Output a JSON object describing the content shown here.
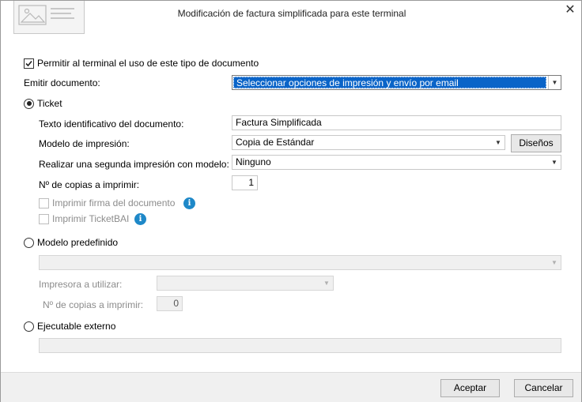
{
  "window": {
    "title": "Modificación de factura simplificada para este terminal"
  },
  "permit": {
    "label": "Permitir al terminal el uso de este tipo de documento",
    "checked": true
  },
  "emit": {
    "label": "Emitir documento:",
    "value": "Seleccionar opciones de impresión y envío por email"
  },
  "ticket": {
    "radio_label": "Ticket",
    "selected": true,
    "text_id_label": "Texto identificativo del documento:",
    "text_id_value": "Factura Simplificada",
    "model_label": "Modelo de impresión:",
    "model_value": "Copia de Estándar",
    "designs_button": "Diseños",
    "second_print_label": "Realizar una segunda impresión con modelo:",
    "second_print_value": "Ninguno",
    "copies_label": "Nº de copias a imprimir:",
    "copies_value": "1",
    "print_signature_label": "Imprimir firma del documento",
    "print_ticketbai_label": "Imprimir TicketBAI"
  },
  "predefined": {
    "radio_label": "Modelo predefinido",
    "model_value": "",
    "printer_label": "Impresora a utilizar:",
    "printer_value": "",
    "copies_label": "Nº de copias a imprimir:",
    "copies_value": "0"
  },
  "external": {
    "radio_label": "Ejecutable externo",
    "value": ""
  },
  "footer": {
    "accept": "Aceptar",
    "cancel": "Cancelar"
  },
  "icons": {
    "info": "info-icon",
    "close": "close-icon",
    "dropdown": "chevron-down-icon"
  },
  "colors": {
    "selection": "#0a64c8",
    "info": "#1e88c8"
  }
}
